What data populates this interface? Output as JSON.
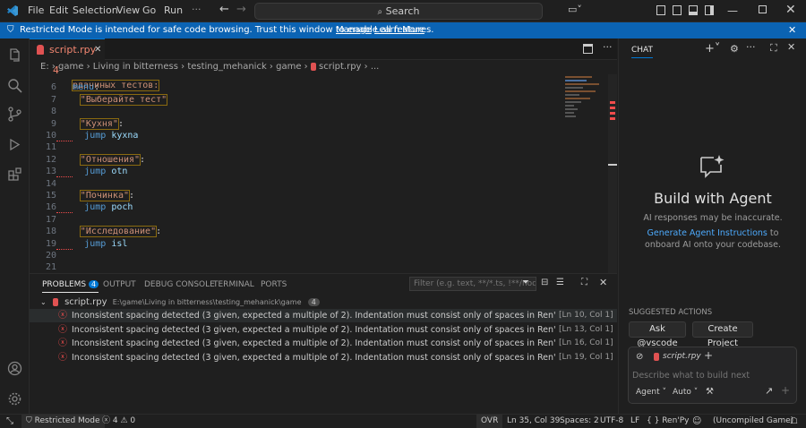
{
  "menu": {
    "items": [
      "File",
      "Edit",
      "Selection",
      "View",
      "Go",
      "Run"
    ]
  },
  "command_center": {
    "label": "Search"
  },
  "banner": {
    "text": "Restricted Mode is intended for safe code browsing. Trust this window to enable all features.",
    "manage": "Manage",
    "learn_more": "Learn More"
  },
  "tab": {
    "name": "script.rpy",
    "count": "4"
  },
  "breadcrumb": {
    "items": [
      "E:",
      "game",
      "Living in bitterness",
      "testing_mehanick",
      "game",
      "script.rpy",
      "..."
    ]
  },
  "code": {
    "partial_top": "рдачиных тестов:",
    "lines": [
      {
        "n": "6",
        "kw": "menu",
        "rest": ":",
        "str": "",
        "indent": 0
      },
      {
        "n": "7",
        "str": "\"Выберайте тест\"",
        "rest": "",
        "indent": 2
      },
      {
        "n": "8",
        "str": "",
        "indent": 0
      },
      {
        "n": "9",
        "str": "\"Кухня\"",
        "rest": ":",
        "indent": 2
      },
      {
        "n": "10",
        "kw": "jump",
        "ident": "kyxna",
        "indent": 3,
        "squig": true
      },
      {
        "n": "11",
        "indent": 0
      },
      {
        "n": "12",
        "str": "\"Отношения\"",
        "rest": ":",
        "indent": 2
      },
      {
        "n": "13",
        "kw": "jump",
        "ident": "otn",
        "indent": 3,
        "squig": true
      },
      {
        "n": "14",
        "indent": 0
      },
      {
        "n": "15",
        "str": "\"Починка\"",
        "rest": ":",
        "indent": 2
      },
      {
        "n": "16",
        "kw": "jump",
        "ident": "poch",
        "indent": 3,
        "squig": true
      },
      {
        "n": "17",
        "indent": 0
      },
      {
        "n": "18",
        "str": "\"Исследование\"",
        "rest": ":",
        "indent": 2
      },
      {
        "n": "19",
        "kw": "jump",
        "ident": "isl",
        "indent": 3,
        "squig": true
      },
      {
        "n": "20",
        "indent": 0
      },
      {
        "n": "21",
        "indent": 0
      }
    ]
  },
  "panel": {
    "tabs": [
      "PROBLEMS",
      "OUTPUT",
      "DEBUG CONSOLE",
      "TERMINAL",
      "PORTS"
    ],
    "problems_count": "4",
    "filter_placeholder": "Filter (e.g. text, **/*.ts, !**/nod...",
    "file": {
      "name": "script.rpy",
      "path": "E:\\game\\Living in bitterness\\testing_mehanick\\game",
      "count": "4"
    },
    "problems": [
      {
        "message": "Inconsistent spacing detected (3 given, expected a multiple of 2). Indentation must consist only of spaces in Ren'Py scripts. Each inde...",
        "loc": "[Ln 10, Col 1]"
      },
      {
        "message": "Inconsistent spacing detected (3 given, expected a multiple of 2). Indentation must consist only of spaces in Ren'Py scripts. Each inde...",
        "loc": "[Ln 13, Col 1]"
      },
      {
        "message": "Inconsistent spacing detected (3 given, expected a multiple of 2). Indentation must consist only of spaces in Ren'Py scripts. Each inde...",
        "loc": "[Ln 16, Col 1]"
      },
      {
        "message": "Inconsistent spacing detected (3 given, expected a multiple of 2). Indentation must consist only of spaces in Ren'Py scripts. Each inde...",
        "loc": "[Ln 19, Col 1]"
      }
    ]
  },
  "chat": {
    "title": "CHAT",
    "heading": "Build with Agent",
    "disclaimer": "AI responses may be inaccurate.",
    "link": "Generate Agent Instructions",
    "link_tail": " to onboard AI onto your codebase.",
    "suggested_title": "SUGGESTED ACTIONS",
    "suggestions": [
      "Ask @vscode",
      "Create Project"
    ],
    "attachment": "script.rpy",
    "input_placeholder": "Describe what to build next",
    "mode": "Agent",
    "model": "Auto"
  },
  "status": {
    "mode": "Restricted Mode",
    "errors": "4",
    "warnings": "0",
    "ovr": "OVR",
    "position": "Ln 35, Col 39",
    "spaces": "Spaces: 2",
    "encoding": "UTF-8",
    "eol": "LF",
    "language": "Ren'Py",
    "game": "(Uncompiled Game)"
  },
  "colors": {
    "accent": "#0078d4",
    "banner": "#0b63b3",
    "error": "#f14c4c",
    "badge": "#0078d4"
  }
}
